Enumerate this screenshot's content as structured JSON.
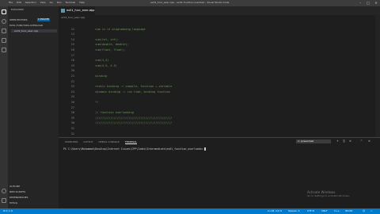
{
  "window": {
    "title": "ex01_func_exec.cpp - ex01-function-overload - Visual Studio Code",
    "menu": [
      "File",
      "Edit",
      "Selection",
      "View",
      "Go",
      "Run",
      "Terminal",
      "Help"
    ],
    "controls": [
      "–",
      "□",
      "✕"
    ]
  },
  "sidebar": {
    "title": "EXPLORER",
    "open_editors": "OPEN EDITORS",
    "open_editors_badge": "1 UNSAVED",
    "folder": "EX01-FUNCTION-OVERLOAD",
    "file": "ex01_func_exec.cpp",
    "outline": "OUTLINE",
    "npm_scripts": "NPM SCRIPTS",
    "dependencies": "DEPENDENCIES",
    "mysql": "MYSQL"
  },
  "tab": {
    "label": "ex01_func_exec.cpp",
    "close": "✕"
  },
  "breadcrumb": "ex01_func_exec.cpp",
  "editor": {
    "lines": [
      {
        "n": "",
        "text": ""
      },
      {
        "n": "12",
        "text": "    num is it programming_language"
      },
      {
        "n": "13",
        "text": ""
      },
      {
        "n": "14",
        "text": "    sum(int, int);"
      },
      {
        "n": "15",
        "text": "    sum(double, double);"
      },
      {
        "n": "16",
        "text": "    sum(float, float);"
      },
      {
        "n": "17",
        "text": ""
      },
      {
        "n": "18",
        "text": "    sum(4,4)"
      },
      {
        "n": "19",
        "text": "    sum(4.5, 4.5)"
      },
      {
        "n": "20",
        "text": ""
      },
      {
        "n": "21",
        "text": "    binding"
      },
      {
        "n": "22",
        "text": ""
      },
      {
        "n": "23",
        "text": "    static binding -> compile, function + variable"
      },
      {
        "n": "24",
        "text": "    dynamic binding -> run time, binding function"
      },
      {
        "n": "25",
        "text": ""
      },
      {
        "n": "26",
        "text": "    */"
      },
      {
        "n": "27",
        "text": ""
      },
      {
        "n": "28",
        "text": "    // function overloading"
      },
      {
        "n": "29",
        "text": "    //////////////////////////////////////////////"
      },
      {
        "n": "30",
        "text": "    //////////////////////////////////////////////"
      },
      {
        "n": "31",
        "text": ""
      },
      {
        "n": "32",
        "text": ""
      }
    ]
  },
  "panel": {
    "tabs": [
      "PROBLEMS",
      "OUTPUT",
      "DEBUG CONSOLE",
      "TERMINAL"
    ],
    "active_tab": "TERMINAL",
    "terminal_select": "1: powershell",
    "controls": [
      "+",
      "◫",
      "✕",
      "^",
      "✕"
    ],
    "terminal_line": "PS C:\\Users\\Mohammed\\Desktop\\Internet Issues\\CPP\\Codes\\Intermediate\\ex01_function_overloads> "
  },
  "watermark": {
    "line1": "Activate Windows",
    "line2": "Go to Settings to activate Windows."
  },
  "statusbar": {
    "left": "⊗ 0 ⚠ 0",
    "right": [
      "Ln 18, Col 9",
      "Spaces: 4",
      "UTF-8",
      "CRLF",
      "C++",
      "Win32"
    ]
  },
  "colors": {
    "accent": "#007acc",
    "comment": "#6a9955",
    "editor_bg": "#1e1e1e"
  }
}
